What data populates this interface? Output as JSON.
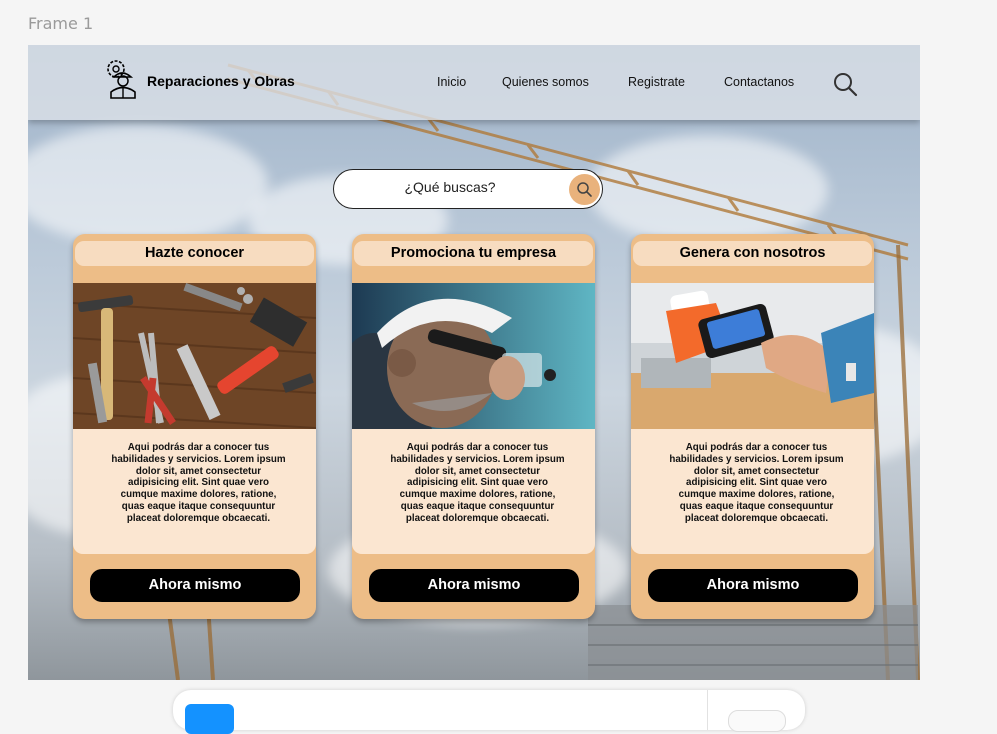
{
  "frame_label": "Frame 1",
  "brand": {
    "name": "Reparaciones y Obras",
    "logo_icon": "worker-gear-icon"
  },
  "nav": {
    "items": [
      "Inicio",
      "Quienes somos",
      "Registrate",
      "Contactanos"
    ],
    "search_icon": "search-icon"
  },
  "search": {
    "placeholder": "¿Qué buscas?",
    "button_icon": "search-icon"
  },
  "cards": [
    {
      "title": "Hazte conocer",
      "image": "tools-on-wood-photo",
      "text": "Aqui podrás dar a conocer tus habilidades y servicios. Lorem ipsum dolor sit, amet consectetur adipisicing elit. Sint quae vero cumque maxime dolores, ratione, quas eaque itaque consequuntur placeat doloremque obcaecati.",
      "button": "Ahora mismo"
    },
    {
      "title": "Promociona tu empresa",
      "image": "electrician-helmet-photo",
      "text": "Aqui podrás dar a conocer tus habilidades y servicios. Lorem ipsum dolor sit, amet consectetur adipisicing elit. Sint quae vero cumque maxime dolores, ratione, quas eaque itaque consequuntur placeat doloremque obcaecati.",
      "button": "Ahora mismo"
    },
    {
      "title": "Genera con nosotros",
      "image": "card-payment-terminal-photo",
      "text": "Aqui podrás dar a conocer tus habilidades y servicios. Lorem ipsum dolor sit, amet consectetur adipisicing elit. Sint quae vero cumque maxime dolores, ratione, quas eaque itaque consequuntur placeat doloremque obcaecati.",
      "button": "Ahora mismo"
    }
  ],
  "colors": {
    "accent": "#edbd87",
    "card_header": "#f7dcc0",
    "card_body": "#fbe6d1",
    "button": "#000000",
    "toolbar_blue": "#1492ff"
  }
}
